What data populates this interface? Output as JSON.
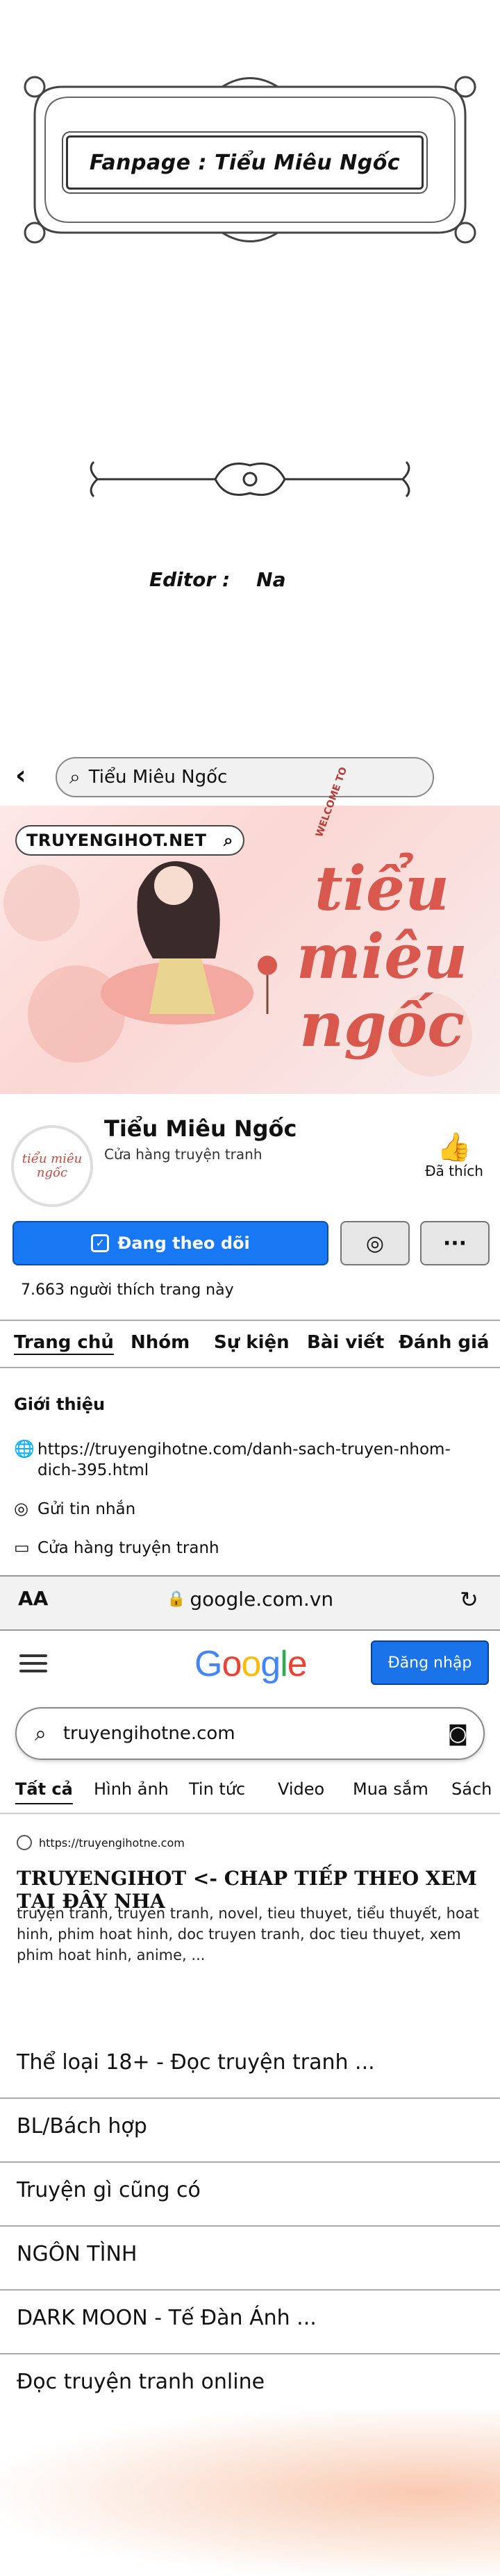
{
  "banner": {
    "fanpage_text": "Fanpage : Tiểu Miêu Ngốc",
    "editor_label": "Editor :",
    "editor_value": "Na"
  },
  "fb": {
    "search_value": "Tiểu Miêu Ngốc",
    "cover_watermark": "TRUYENGIHOT.NET",
    "cover_tagline": "WELCOME TO",
    "cover_title": "tiểu miêu ngốc",
    "avatar_text": "tiểu miêu ngốc",
    "page_name": "Tiểu Miêu Ngốc",
    "page_subtitle": "Cửa hàng truyện tranh",
    "like_label": "Đã thích",
    "follow_label": "Đang theo dõi",
    "likes_count": "7.663 người thích trang này",
    "tabs": [
      "Trang chủ",
      "Nhóm",
      "Sự kiện",
      "Bài viết",
      "Đánh giá"
    ],
    "intro_heading": "Giới thiệu",
    "intro_link": "https://truyengihotne.com/danh-sach-truyen-nhom-dich-395.html",
    "intro_message": "Gửi tin nhắn",
    "intro_shop": "Cửa hàng truyện tranh"
  },
  "browser": {
    "aa": "AA",
    "url": "google.com.vn"
  },
  "google": {
    "logo": "Google",
    "signin_label": "Đăng nhập",
    "search_value": "truyengihotne.com",
    "tabs": [
      "Tất cả",
      "Hình ảnh",
      "Tin tức",
      "Video",
      "Mua sắm",
      "Sách"
    ],
    "result_url": "https://truyengihotne.com",
    "result_title": "TRUYENGIHOT <- CHAP TIẾP THEO XEM TẠI ĐÂY NHA",
    "result_snippet": "truyện tranh, truyen tranh, novel, tieu thuyet, tiểu thuyết, hoat hinh, phim hoat hinh, doc truyen tranh, doc tieu thuyet, xem phim hoat hinh, anime, ...",
    "links": [
      "Thể loại 18+ - Đọc truyện tranh ...",
      "BL/Bách hợp",
      "Truyện gì cũng có",
      "NGÔN TÌNH",
      "DARK MOON - Tế Đàn Ánh ...",
      "Đọc truyện tranh online"
    ]
  },
  "colors": {
    "fb_blue": "#1877f2",
    "google_blue": "#1a73e8",
    "cover_pink": "#d9584d"
  }
}
